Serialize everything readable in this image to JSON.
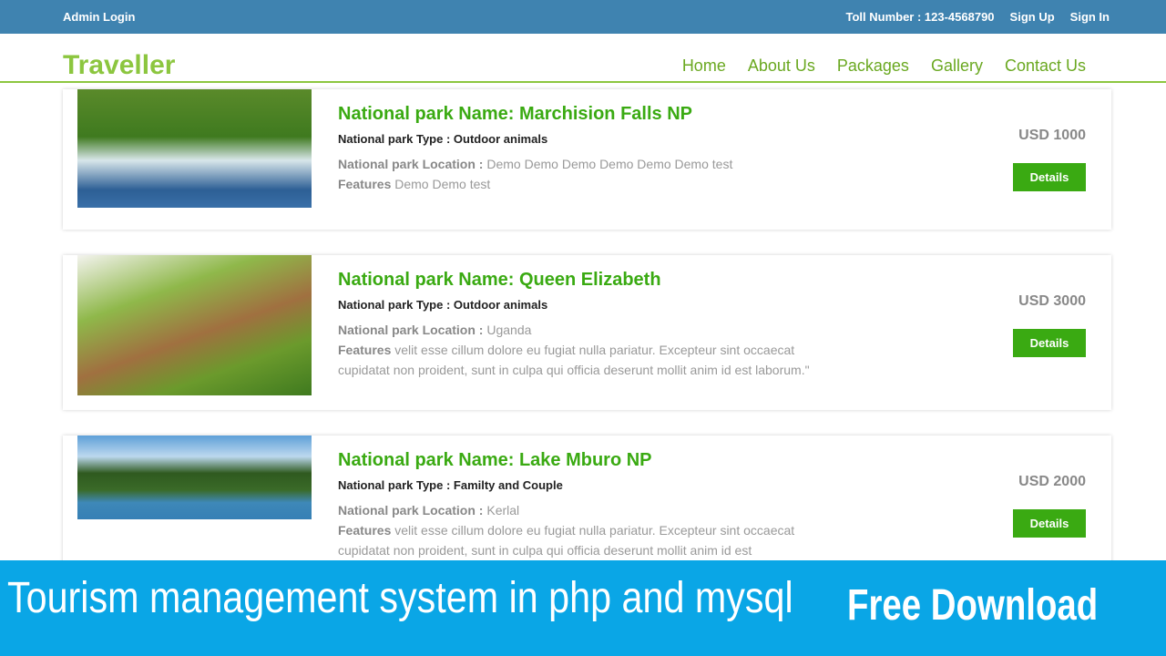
{
  "topbar": {
    "admin": "Admin Login",
    "toll": "Toll Number : 123-4568790",
    "signup": "Sign Up",
    "signin": "Sign In"
  },
  "header": {
    "logo": "Traveller",
    "nav": [
      "Home",
      "About Us",
      "Packages",
      "Gallery",
      "Contact Us"
    ]
  },
  "parks": [
    {
      "name": "National park Name: Marchision Falls NP",
      "type": "National park Type : Outdoor animals",
      "loc_label": "National park Location :",
      "loc": "Demo Demo Demo Demo Demo Demo test",
      "feat_label": "Features",
      "feat": "Demo Demo test",
      "price": "USD 1000",
      "button": "Details"
    },
    {
      "name": "National park Name: Queen Elizabeth",
      "type": "National park Type : Outdoor animals",
      "loc_label": "National park Location :",
      "loc": "Uganda",
      "feat_label": "Features",
      "feat": "velit esse cillum dolore eu fugiat nulla pariatur. Excepteur sint occaecat cupidatat non proident, sunt in culpa qui officia deserunt mollit anim id est laborum.\"",
      "price": "USD 3000",
      "button": "Details"
    },
    {
      "name": "National park Name: Lake Mburo NP",
      "type": "National park Type : Familty and Couple",
      "loc_label": "National park Location :",
      "loc": "Kerlal",
      "feat_label": "Features",
      "feat": "velit esse cillum dolore eu fugiat nulla pariatur. Excepteur sint occaecat cupidatat non proident, sunt in culpa qui officia deserunt mollit anim id est",
      "price": "USD 2000",
      "button": "Details"
    }
  ],
  "banner": {
    "title": "Tourism management system in php and mysql",
    "cta": "Free Download"
  }
}
